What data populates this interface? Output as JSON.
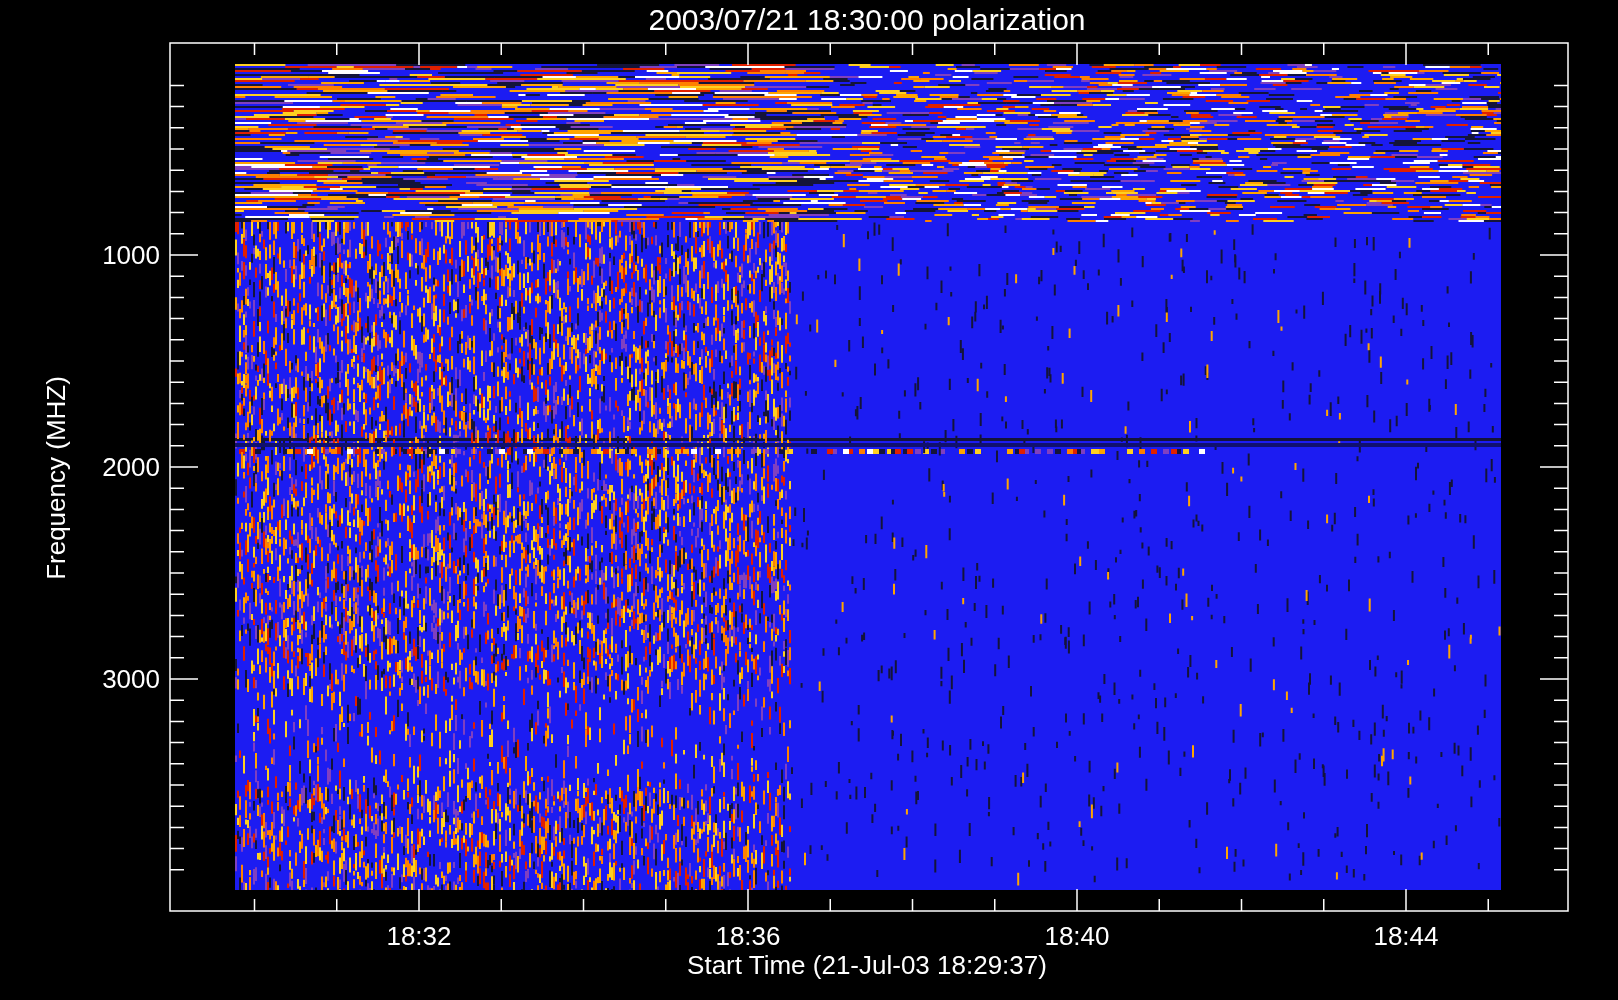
{
  "plot": {
    "title": "2003/07/21 18:30:00 polarization",
    "ylabel": "Frequency (MHZ)",
    "xlabel": "Start Time (21-Jul-03 18:29:37)",
    "yticks": [
      "1000",
      "2000",
      "3000"
    ],
    "xticks": [
      "18:32",
      "18:36",
      "18:40",
      "18:44"
    ]
  }
}
